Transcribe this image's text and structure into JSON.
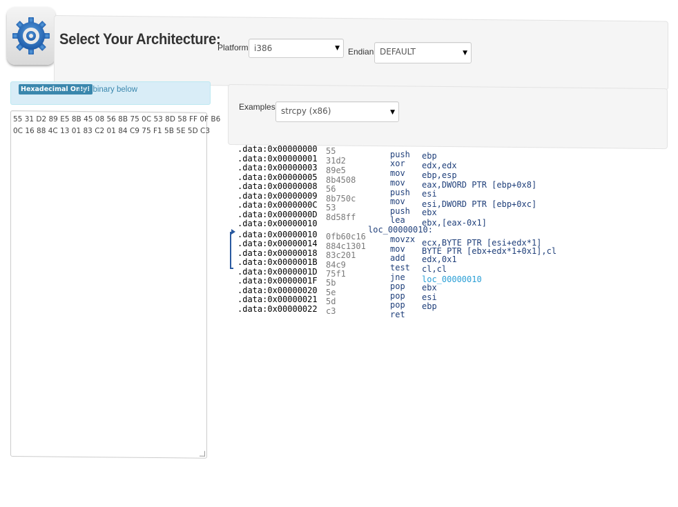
{
  "header": {
    "title": "Select Your Architecture:",
    "platform_label": "Platform",
    "platform_value": "i386",
    "endian_label": "Endian",
    "endian_value": "DEFAULT"
  },
  "input_panel": {
    "badge": "Hexadecimal Only!",
    "hint": "Put binary below",
    "hex_lines": [
      "55 31 D2 89 E5 8B 45 08 56 8B 75 0C 53 8D 58 FF 0F B6",
      "0C 16 88 4C 13 01 83 C2 01 84 C9 75 F1 5B 5E 5D C3"
    ]
  },
  "examples": {
    "label": "Examples:",
    "value": "strcpy (x86)"
  },
  "disassembly": {
    "addresses": [
      ".data:0x00000000",
      ".data:0x00000001",
      ".data:0x00000003",
      ".data:0x00000005",
      ".data:0x00000008",
      ".data:0x00000009",
      ".data:0x0000000C",
      ".data:0x0000000D",
      ".data:0x00000010",
      ".data:0x00000010",
      ".data:0x00000014",
      ".data:0x00000018",
      ".data:0x0000001B",
      ".data:0x0000001D",
      ".data:0x0000001F",
      ".data:0x00000020",
      ".data:0x00000021",
      ".data:0x00000022"
    ],
    "bytes": [
      "55",
      "31d2",
      "89e5",
      "8b4508",
      "56",
      "8b750c",
      "53",
      "8d58ff",
      "0fb60c16",
      "884c1301",
      "83c201",
      "84c9",
      "75f1",
      "5b",
      "5e",
      "5d",
      "c3"
    ],
    "label": "loc_00000010:",
    "instructions": [
      {
        "mn": "push",
        "op": "ebp"
      },
      {
        "mn": "xor",
        "op": "edx,edx"
      },
      {
        "mn": "mov",
        "op": "ebp,esp"
      },
      {
        "mn": "mov",
        "op": "eax,DWORD PTR [ebp+0x8]"
      },
      {
        "mn": "push",
        "op": "esi"
      },
      {
        "mn": "mov",
        "op": "esi,DWORD PTR [ebp+0xc]"
      },
      {
        "mn": "push",
        "op": "ebx"
      },
      {
        "mn": "lea",
        "op": "ebx,[eax-0x1]"
      },
      {
        "mn": "movzx",
        "op": "ecx,BYTE PTR [esi+edx*1]"
      },
      {
        "mn": "mov",
        "op": "BYTE PTR [ebx+edx*1+0x1],cl"
      },
      {
        "mn": "add",
        "op": "edx,0x1"
      },
      {
        "mn": "test",
        "op": "cl,cl"
      },
      {
        "mn": "jne",
        "op": "loc_00000010"
      },
      {
        "mn": "pop",
        "op": "ebx"
      },
      {
        "mn": "pop",
        "op": "esi"
      },
      {
        "mn": "pop",
        "op": "ebp"
      },
      {
        "mn": "ret",
        "op": ""
      }
    ]
  },
  "colors": {
    "badge": "#3a87ad",
    "alert_bg": "#d9edf7",
    "mnemonic": "#1f3f7a",
    "link": "#2a9fd6"
  }
}
